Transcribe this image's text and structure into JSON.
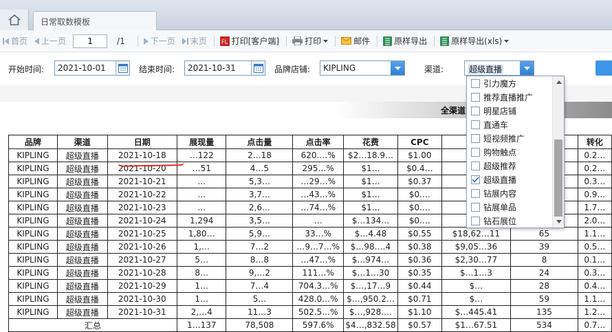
{
  "tab": {
    "title": "日常取数模板"
  },
  "toolbar": {
    "first": "首页",
    "prev": "上一页",
    "page_value": "1",
    "page_total": "/1",
    "next": "下一页",
    "last": "末页",
    "print_client": "打印[客户端]",
    "print": "打印",
    "mail": "邮件",
    "export": "原样导出",
    "export_xls": "原样导出(xls)"
  },
  "params": {
    "start_label": "开始时间:",
    "start_value": "2021-10-01",
    "end_label": "结束时间:",
    "end_value": "2021-10-31",
    "store_label": "品牌店铺:",
    "store_value": "KIPLING",
    "channel_label": "渠道:",
    "channel_value": "超级直播"
  },
  "report": {
    "title": "全渠道",
    "headers": [
      "品牌",
      "渠道",
      "日期",
      "展现量",
      "点击量",
      "点击率",
      "花费",
      "CPC",
      "",
      "",
      "转化"
    ],
    "rows": [
      [
        "KIPLING",
        "超级直播",
        "2021-10-18",
        "…122",
        "2…18",
        "620.…%",
        "$2…18.9…",
        "$1.00",
        "",
        "",
        "0.2…"
      ],
      [
        "KIPLING",
        "超级直播",
        "2021-10-20",
        "…51",
        "4…5",
        "295…%",
        "$1…",
        "$0.4…",
        "",
        "",
        "0.2…"
      ],
      [
        "KIPLING",
        "超级直播",
        "2021-10-21",
        "…",
        "5,3…",
        "…29…%",
        "$1…",
        "$0.37",
        "",
        "",
        "0.3…"
      ],
      [
        "KIPLING",
        "超级直播",
        "2021-10-22",
        "…",
        "3,7…",
        "…43…%",
        "$1…",
        "$0.…",
        "",
        "",
        "0.9…"
      ],
      [
        "KIPLING",
        "超级直播",
        "2021-10-23",
        "…",
        "2,6…",
        "…74…%",
        "$1…",
        "$0.…",
        "",
        "",
        "1.7…"
      ],
      [
        "KIPLING",
        "超级直播",
        "2021-10-24",
        "1,294",
        "3,5…",
        "…",
        "$…134…",
        "$0.…",
        "",
        "",
        "2.0…"
      ],
      [
        "KIPLING",
        "超级直播",
        "2021-10-25",
        "1,80…",
        "5,9…",
        "33…%",
        "$…4.48",
        "$0.55",
        "$18,62…11",
        "65",
        "1.1…"
      ],
      [
        "KIPLING",
        "超级直播",
        "2021-10-26",
        "1,…",
        "7…2",
        "…9…7…%",
        "$…98.…4",
        "$0.38",
        "$9,05…36",
        "39",
        "0.5…"
      ],
      [
        "KIPLING",
        "超级直播",
        "2021-10-27",
        "5…",
        "8…8",
        "…47…%",
        "$…974…",
        "$0.36",
        "$2,30…77",
        "8",
        "0.1…"
      ],
      [
        "KIPLING",
        "超级直播",
        "2021-10-28",
        "8…",
        "9,…2",
        "111…%",
        "$…1…30",
        "$0.35",
        "$…1…3",
        "24",
        "0.3…"
      ],
      [
        "KIPLING",
        "超级直播",
        "2021-10-29",
        "1…",
        "7…4",
        "704.3…%",
        "$…,17…9",
        "$0.44",
        "$…",
        "28",
        "0.4…"
      ],
      [
        "KIPLING",
        "超级直播",
        "2021-10-30",
        "1…",
        "5…",
        "428.0…%",
        "$…,950.2…",
        "$0.71",
        "$…",
        "59",
        "1.1…"
      ],
      [
        "KIPLING",
        "超级直播",
        "2021-10-31",
        "2,…4",
        "11…3",
        "502.5…%",
        "$…,928.…",
        "$1.10",
        "$…445.41",
        "135",
        "1.2…"
      ]
    ],
    "total": [
      "汇总",
      "1…137",
      "78,508",
      "597.6%",
      "$4…,832.58",
      "$0.57",
      "$1…67.51",
      "534",
      "0.7…"
    ]
  },
  "channel_dropdown": {
    "options": [
      {
        "label": "引力魔方",
        "checked": false
      },
      {
        "label": "推荐直播推广",
        "checked": false
      },
      {
        "label": "明星店铺",
        "checked": false
      },
      {
        "label": "直通车",
        "checked": false
      },
      {
        "label": "短视频推广",
        "checked": false
      },
      {
        "label": "购物触点",
        "checked": false
      },
      {
        "label": "超级推荐",
        "checked": false
      },
      {
        "label": "超级直播",
        "checked": true
      },
      {
        "label": "钻展内容",
        "checked": false
      },
      {
        "label": "钻展单品",
        "checked": false
      },
      {
        "label": "钻石展位",
        "checked": false
      }
    ]
  },
  "colors": {
    "accent": "#3d95e8",
    "annotation": "#e0251b",
    "checkmark": "#2f7fd6"
  },
  "icons": [
    "home-icon",
    "first-page-icon",
    "prev-page-icon",
    "next-page-icon",
    "last-page-icon",
    "print-client-icon",
    "print-icon",
    "mail-icon",
    "excel-export-icon",
    "calendar-icon",
    "dropdown-arrow-icon",
    "checkmark-icon"
  ]
}
